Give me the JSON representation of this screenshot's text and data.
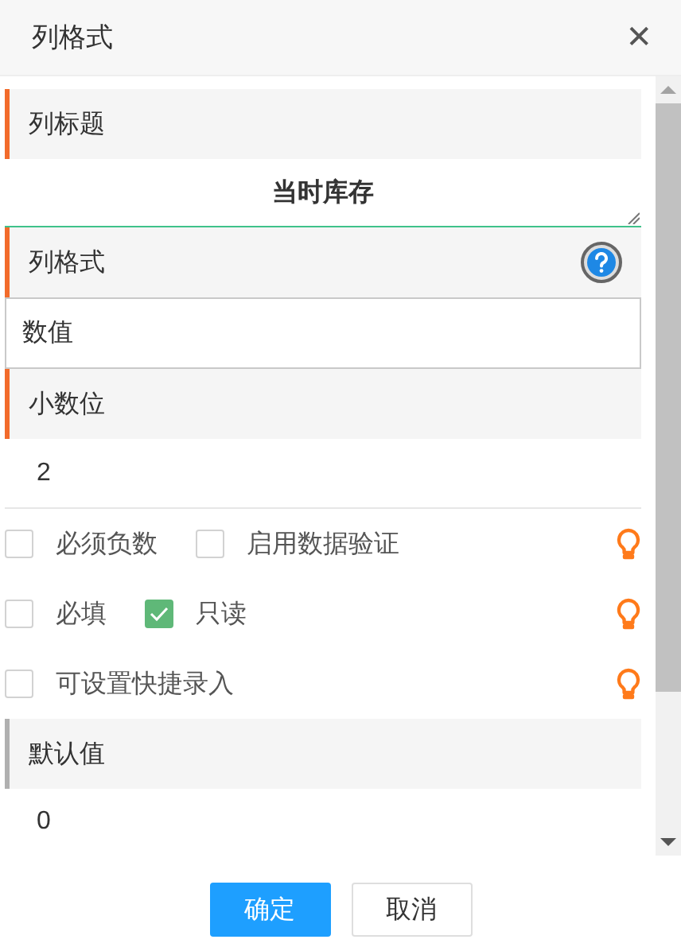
{
  "window": {
    "title": "列格式",
    "close": "✕"
  },
  "rows": [
    {
      "kind": "header",
      "label": "列标题",
      "color": "#f26b2b",
      "help": false
    },
    {
      "kind": "textarea",
      "value": "当时库存"
    },
    {
      "kind": "header",
      "label": "列格式",
      "color": "#f26b2b",
      "help": true
    },
    {
      "kind": "select",
      "value": "数值"
    },
    {
      "kind": "header",
      "label": "小数位",
      "color": "#f26b2b",
      "help": false
    },
    {
      "kind": "value",
      "value": "2"
    },
    {
      "kind": "checks",
      "options": [
        {
          "label": "必须负数",
          "checked": false
        },
        {
          "label": "启用数据验证",
          "checked": false
        }
      ]
    },
    {
      "kind": "checks",
      "options": [
        {
          "label": "必填",
          "checked": false
        },
        {
          "label": "只读",
          "checked": true
        }
      ]
    },
    {
      "kind": "checks",
      "options": [
        {
          "label": "可设置快捷录入",
          "checked": false
        }
      ]
    },
    {
      "kind": "header",
      "label": "默认值",
      "color": "#b0b0b0",
      "help": false
    },
    {
      "kind": "value",
      "value": "0"
    }
  ],
  "buttons": [
    {
      "label": "确定",
      "kind": "primary"
    },
    {
      "label": "取消",
      "kind": "secondary"
    }
  ]
}
